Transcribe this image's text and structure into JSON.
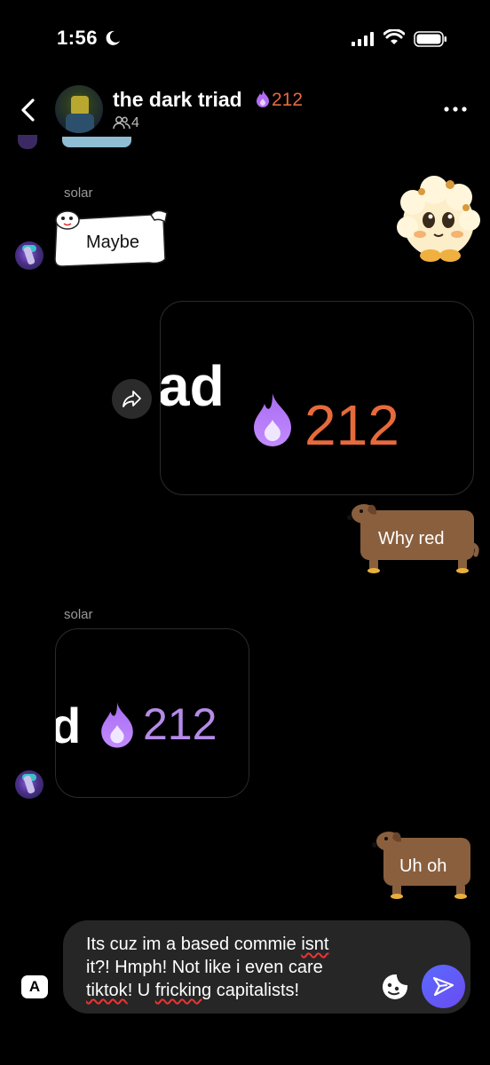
{
  "status_bar": {
    "time": "1:56"
  },
  "header": {
    "title": "the dark triad",
    "streak_count": "212",
    "member_count": "4"
  },
  "messages": [
    {
      "sender": "solar",
      "sticker_text": "Maybe"
    },
    {
      "card_text": "ad",
      "card_count": "212"
    },
    {
      "sticker_text": "Why red"
    },
    {
      "sender": "solar",
      "card_text": "d",
      "card_count": "212"
    },
    {
      "sticker_text": "Uh oh"
    }
  ],
  "composer": {
    "line1_a": "Its cuz im a based commie ",
    "line1_b": "isnt",
    "line2": "it?! Hmph! Not like i even care",
    "line3_a": "tiktok",
    "line3_b": "! U ",
    "line3_c": "fricking",
    "line3_d": " capitalists!",
    "keyboard_label": "A"
  },
  "colors": {
    "background": "#000000",
    "streak_orange": "#e66a3c",
    "streak_purple": "#b58be8",
    "send_blue": "#5a6bff",
    "composer_bg": "#262626"
  }
}
